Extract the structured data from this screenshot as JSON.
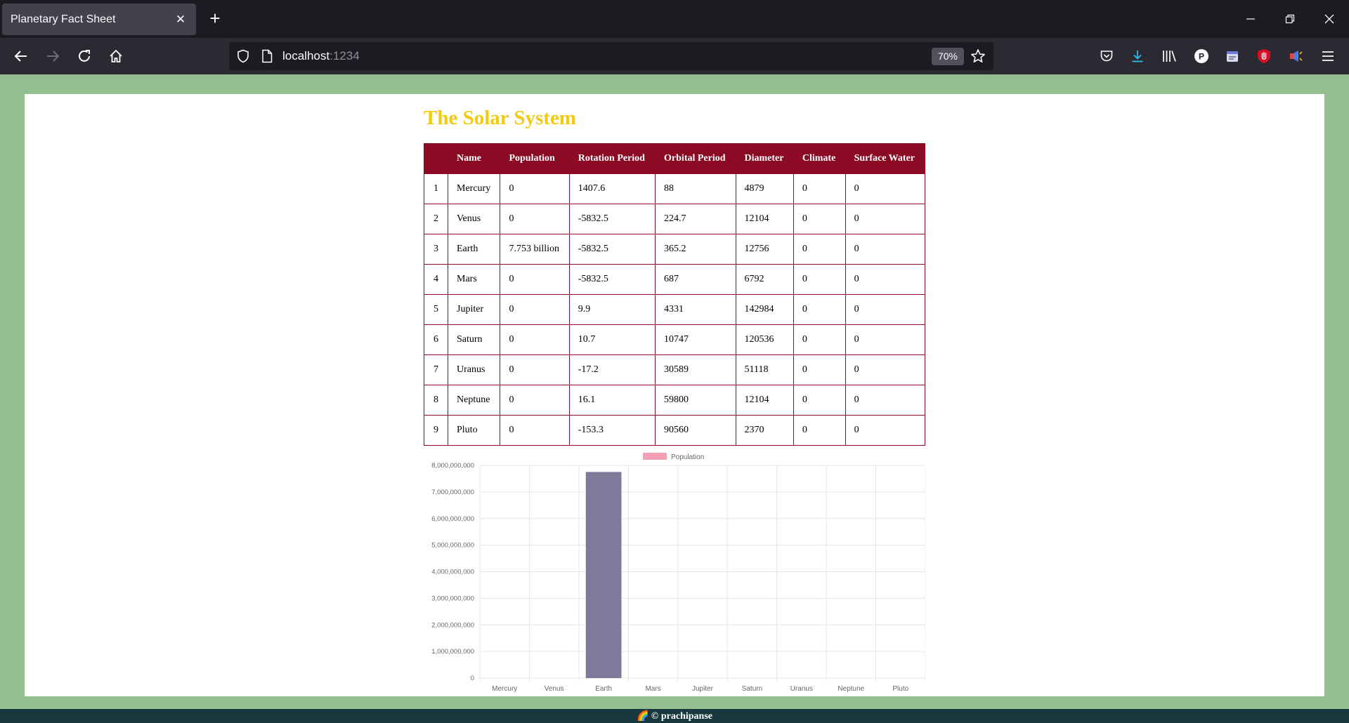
{
  "browser": {
    "tab_title": "Planetary Fact Sheet",
    "url_host": "localhost",
    "url_port": ":1234",
    "zoom": "70%"
  },
  "page": {
    "title": "The Solar System",
    "footer": "🌈 © prachipanse"
  },
  "table": {
    "headers": [
      "",
      "Name",
      "Population",
      "Rotation Period",
      "Orbital Period",
      "Diameter",
      "Climate",
      "Surface Water"
    ],
    "rows": [
      [
        "1",
        "Mercury",
        "0",
        "1407.6",
        "88",
        "4879",
        "0",
        "0"
      ],
      [
        "2",
        "Venus",
        "0",
        "-5832.5",
        "224.7",
        "12104",
        "0",
        "0"
      ],
      [
        "3",
        "Earth",
        "7.753 billion",
        "-5832.5",
        "365.2",
        "12756",
        "0",
        "0"
      ],
      [
        "4",
        "Mars",
        "0",
        "-5832.5",
        "687",
        "6792",
        "0",
        "0"
      ],
      [
        "5",
        "Jupiter",
        "0",
        "9.9",
        "4331",
        "142984",
        "0",
        "0"
      ],
      [
        "6",
        "Saturn",
        "0",
        "10.7",
        "10747",
        "120536",
        "0",
        "0"
      ],
      [
        "7",
        "Uranus",
        "0",
        "-17.2",
        "30589",
        "51118",
        "0",
        "0"
      ],
      [
        "8",
        "Neptune",
        "0",
        "16.1",
        "59800",
        "12104",
        "0",
        "0"
      ],
      [
        "9",
        "Pluto",
        "0",
        "-153.3",
        "90560",
        "2370",
        "0",
        "0"
      ]
    ]
  },
  "chart_data": {
    "type": "bar",
    "categories": [
      "Mercury",
      "Venus",
      "Earth",
      "Mars",
      "Jupiter",
      "Saturn",
      "Uranus",
      "Neptune",
      "Pluto"
    ],
    "series": [
      {
        "name": "Population",
        "values": [
          0,
          0,
          7753000000,
          0,
          0,
          0,
          0,
          0,
          0
        ],
        "legend_color": "#f4a0b4",
        "bar_color": "#807a9a"
      }
    ],
    "y_ticks": [
      "8,000,000,000",
      "7,000,000,000",
      "6,000,000,000",
      "5,000,000,000",
      "4,000,000,000",
      "3,000,000,000",
      "2,000,000,000",
      "1,000,000,000",
      "0"
    ],
    "ylim": [
      0,
      8000000000
    ],
    "grid": true,
    "legend_position": "top"
  }
}
